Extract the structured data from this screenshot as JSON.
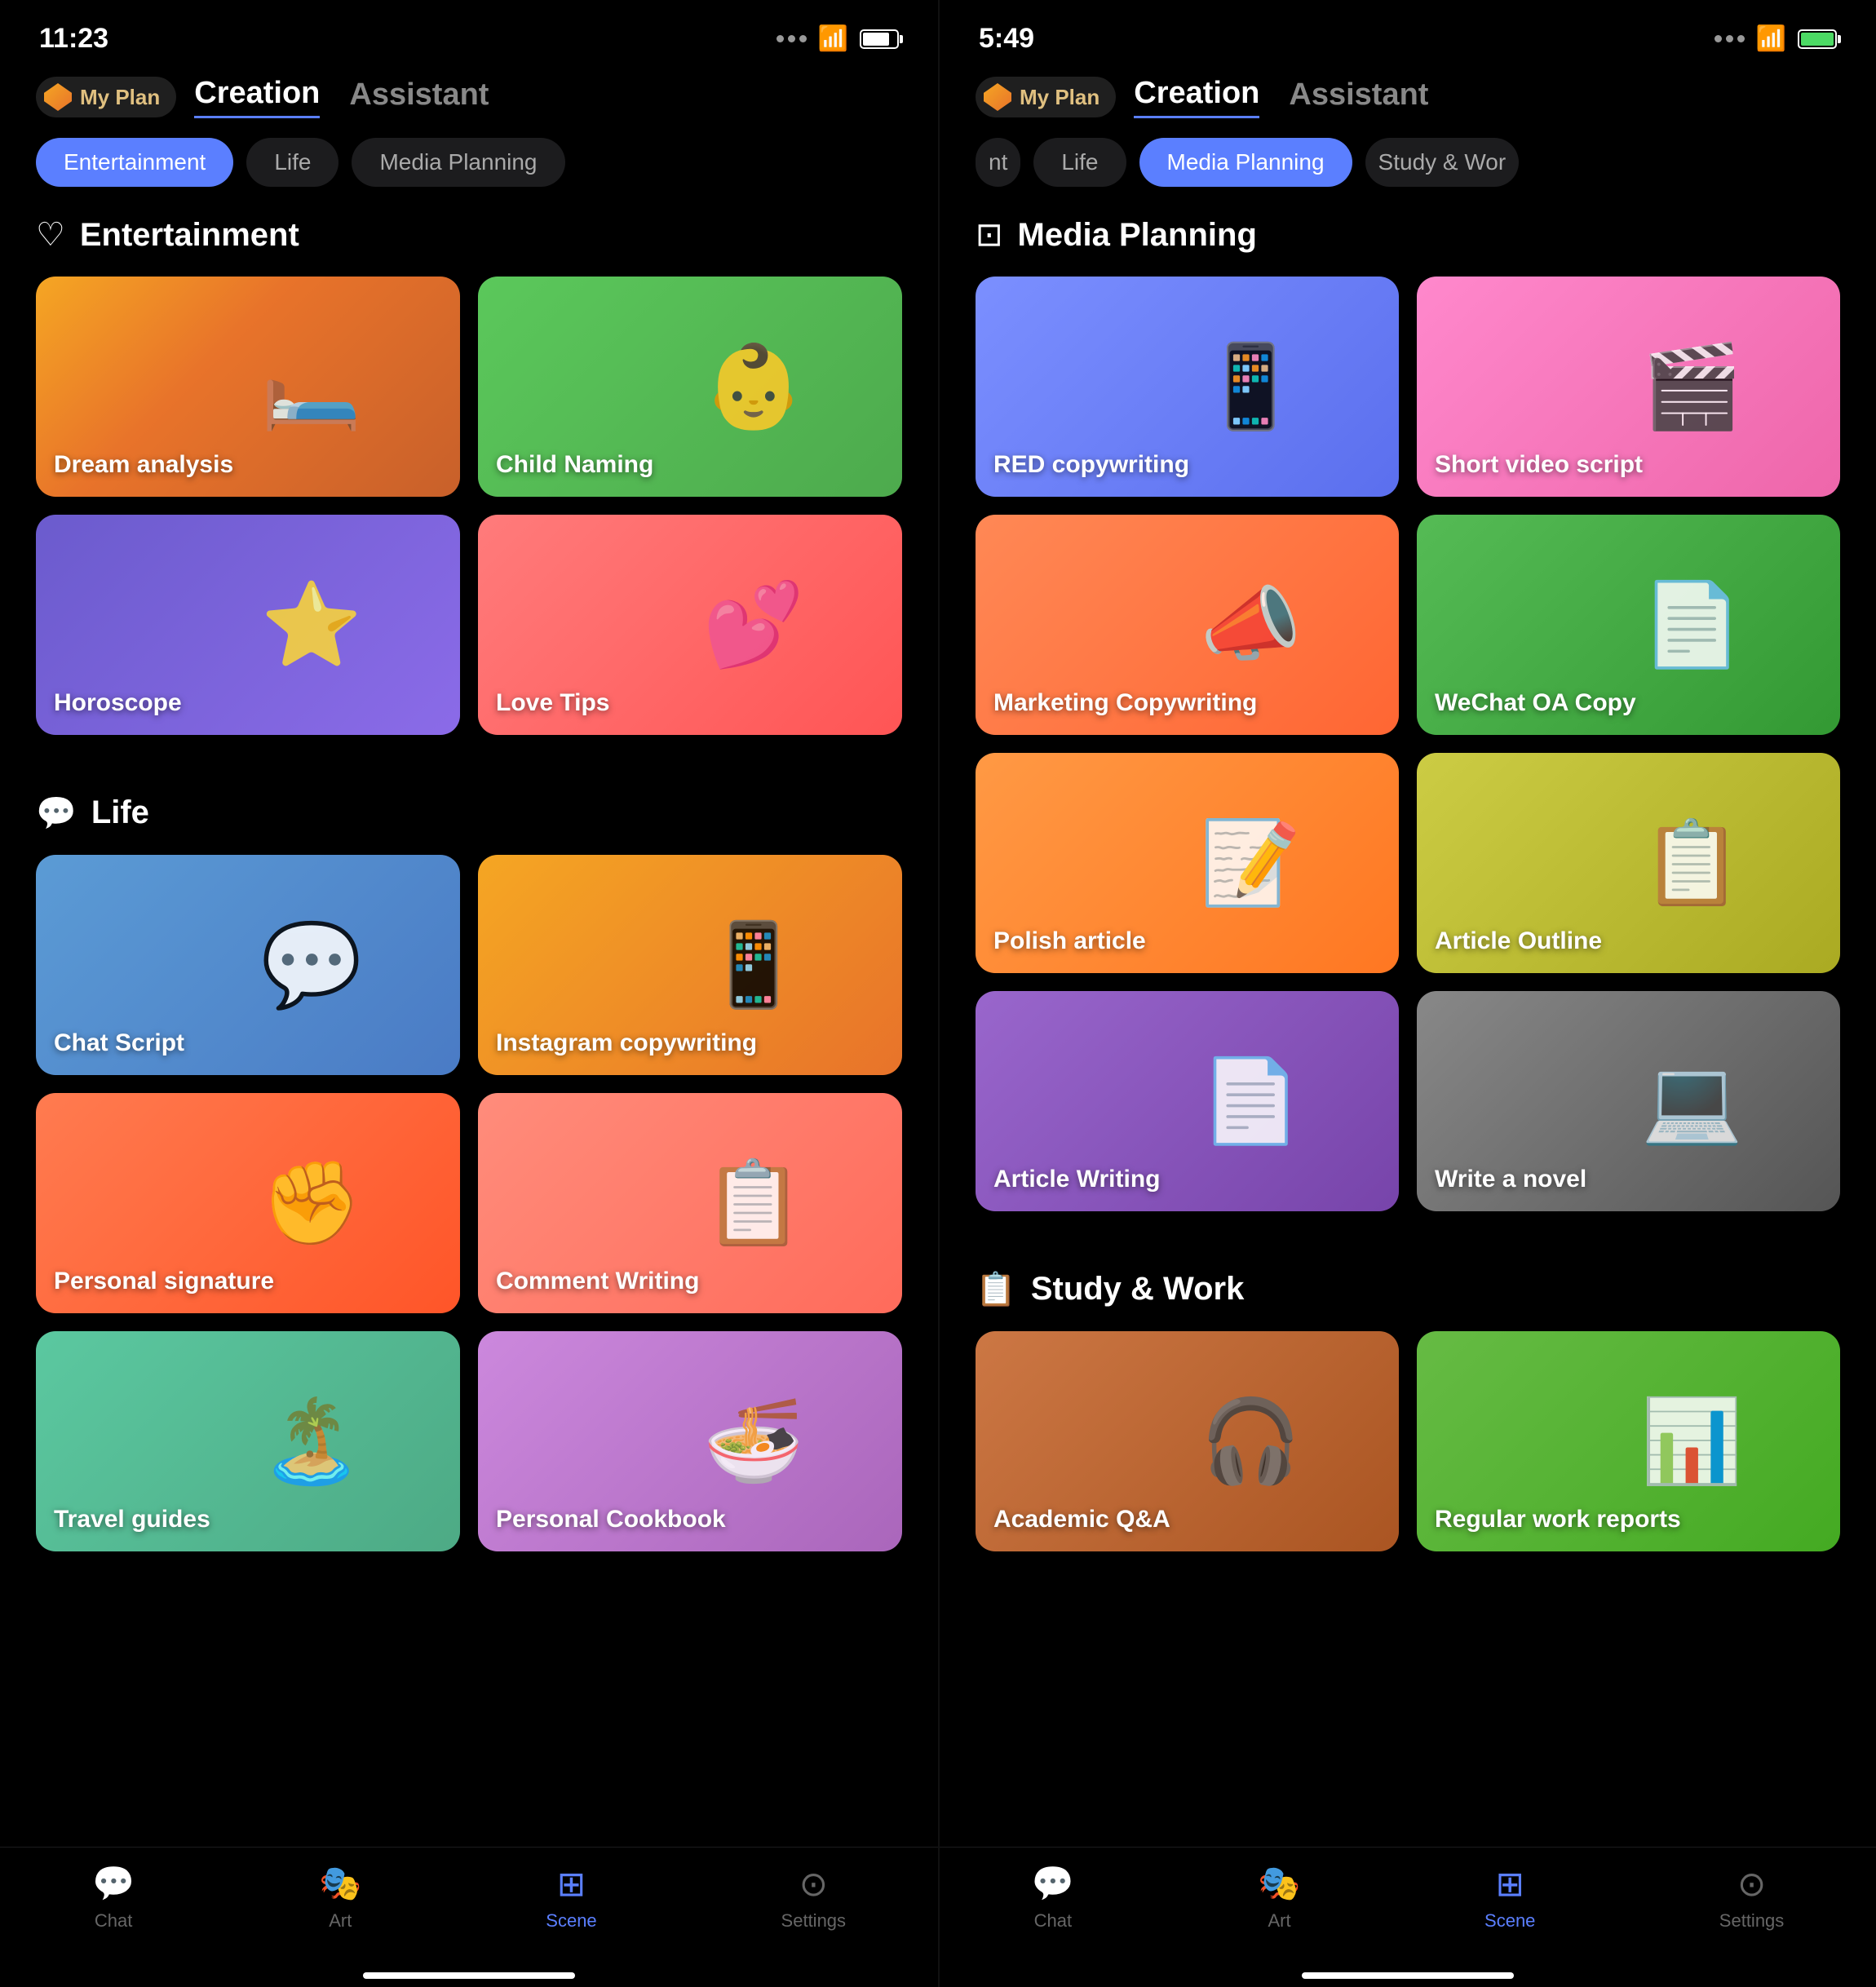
{
  "left_phone": {
    "status": {
      "time": "11:23",
      "battery_percent": 80
    },
    "header": {
      "my_plan": "My Plan",
      "nav_creation": "Creation",
      "nav_assistant": "Assistant",
      "active_nav": "Creation"
    },
    "filter_tabs": [
      {
        "label": "Entertainment",
        "active": true
      },
      {
        "label": "Life",
        "active": false
      },
      {
        "label": "Media Planning",
        "active": false
      }
    ],
    "sections": [
      {
        "id": "entertainment",
        "icon": "♡",
        "title": "Entertainment",
        "cards": [
          {
            "id": "dream-analysis",
            "label": "Dream analysis",
            "bg": "dream",
            "ill": "🛏️"
          },
          {
            "id": "child-naming",
            "label": "Child Naming",
            "bg": "child-naming",
            "ill": "👶"
          },
          {
            "id": "horoscope",
            "label": "Horoscope",
            "bg": "horoscope",
            "ill": "⭐"
          },
          {
            "id": "love-tips",
            "label": "Love Tips",
            "bg": "love-tips",
            "ill": "💕"
          }
        ]
      },
      {
        "id": "life",
        "icon": "💬",
        "title": "Life",
        "cards": [
          {
            "id": "chat-script",
            "label": "Chat Script",
            "bg": "chat-script",
            "ill": "💬"
          },
          {
            "id": "instagram",
            "label": "Instagram copywriting",
            "bg": "instagram",
            "ill": "📱"
          },
          {
            "id": "personal-sig",
            "label": "Personal signature",
            "bg": "personal-sig",
            "ill": "✊"
          },
          {
            "id": "comment",
            "label": "Comment Writing",
            "bg": "comment",
            "ill": "📋"
          },
          {
            "id": "travel",
            "label": "Travel guides",
            "bg": "travel",
            "ill": "🏝️"
          },
          {
            "id": "cookbook",
            "label": "Personal Cookbook",
            "bg": "cookbook",
            "ill": "🍜"
          }
        ]
      }
    ],
    "bottom_nav": [
      {
        "id": "chat",
        "icon": "💬",
        "label": "Chat",
        "active": false
      },
      {
        "id": "art",
        "icon": "🎭",
        "label": "Art",
        "active": false
      },
      {
        "id": "scene",
        "icon": "⊞",
        "label": "Scene",
        "active": true
      },
      {
        "id": "settings",
        "icon": "⊙",
        "label": "Settings",
        "active": false
      }
    ]
  },
  "right_phone": {
    "status": {
      "time": "5:49",
      "battery_percent": 100,
      "battery_green": true
    },
    "header": {
      "my_plan": "My Plan",
      "nav_creation": "Creation",
      "nav_assistant": "Assistant",
      "active_nav": "Creation"
    },
    "filter_tabs": [
      {
        "label": "nt",
        "active": false
      },
      {
        "label": "Life",
        "active": false
      },
      {
        "label": "Media Planning",
        "active": true
      },
      {
        "label": "Study & Wor",
        "active": false
      }
    ],
    "sections": [
      {
        "id": "media-planning",
        "icon": "⊡",
        "title": "Media Planning",
        "cards": [
          {
            "id": "red-copy",
            "label": "RED copywriting",
            "bg": "red-copy",
            "ill": "📱"
          },
          {
            "id": "short-video",
            "label": "Short video script",
            "bg": "short-video",
            "ill": "🎬"
          },
          {
            "id": "marketing",
            "label": "Marketing Copywriting",
            "bg": "marketing",
            "ill": "📣"
          },
          {
            "id": "wechat",
            "label": "WeChat OA Copy",
            "bg": "wechat",
            "ill": "📄"
          },
          {
            "id": "polish",
            "label": "Polish article",
            "bg": "polish",
            "ill": "📝"
          },
          {
            "id": "article-outline",
            "label": "Article Outline",
            "bg": "article-outline",
            "ill": "📋"
          },
          {
            "id": "article-writing",
            "label": "Article Writing",
            "bg": "article-writing",
            "ill": "📄"
          },
          {
            "id": "novel",
            "label": "Write a novel",
            "bg": "novel",
            "ill": "💻"
          }
        ]
      },
      {
        "id": "study-work",
        "icon": "📋",
        "title": "Study & Work",
        "cards": [
          {
            "id": "academic",
            "label": "Academic Q&A",
            "bg": "academic",
            "ill": "🎧"
          },
          {
            "id": "work-reports",
            "label": "Regular work reports",
            "bg": "work-reports",
            "ill": "📊"
          }
        ]
      }
    ],
    "bottom_nav": [
      {
        "id": "chat",
        "icon": "💬",
        "label": "Chat",
        "active": false
      },
      {
        "id": "art",
        "icon": "🎭",
        "label": "Art",
        "active": false
      },
      {
        "id": "scene",
        "icon": "⊞",
        "label": "Scene",
        "active": true
      },
      {
        "id": "settings",
        "icon": "⊙",
        "label": "Settings",
        "active": false
      }
    ]
  }
}
